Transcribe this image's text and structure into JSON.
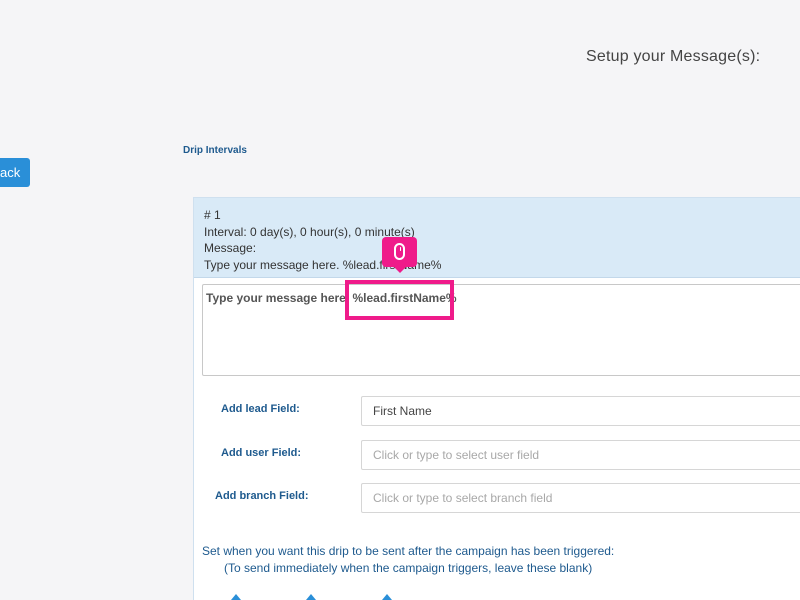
{
  "header": {
    "title": "Setup your Message(s):",
    "back_label": "ack"
  },
  "section": {
    "label": "Drip Intervals"
  },
  "drip": {
    "number": "# 1",
    "interval": "Interval: 0 day(s), 0 hour(s), 0 minute(s)",
    "message_label": "Message:",
    "message_preview": "Type your message here. %lead.firstName%",
    "message_body": "Type your message here. %lead.firstName%"
  },
  "fields": {
    "lead": {
      "label": "Add lead Field:",
      "value": "First Name",
      "placeholder": ""
    },
    "user": {
      "label": "Add user Field:",
      "value": "",
      "placeholder": "Click or type to select user field"
    },
    "branch": {
      "label": "Add branch Field:",
      "value": "",
      "placeholder": "Click or type to select branch field"
    }
  },
  "timing": {
    "note_line1": "Set when you want this drip to be sent after the campaign has been triggered:",
    "note_line2": "(To send immediately when the campaign triggers, leave these blank)"
  },
  "annotation": {
    "highlight_color": "#ef1b8a",
    "cursor_icon": "mouse-icon"
  },
  "colors": {
    "accent": "#2a8fd8",
    "label_blue": "#1e5a8e",
    "header_bg": "#d9eaf7"
  }
}
